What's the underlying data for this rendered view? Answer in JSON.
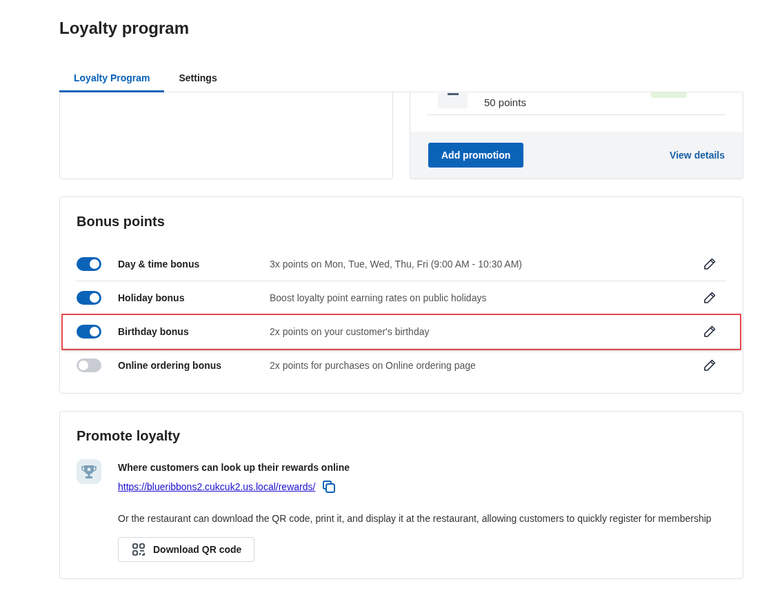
{
  "page": {
    "title": "Loyalty program"
  },
  "tabs": [
    {
      "label": "Loyalty Program",
      "selected": true
    },
    {
      "label": "Settings",
      "selected": false
    }
  ],
  "promotion_card": {
    "item_points": "50 points",
    "primary_button": "Add promotion",
    "link": "View details"
  },
  "bonus_points": {
    "title": "Bonus points",
    "rows": [
      {
        "name": "Day & time bonus",
        "description": "3x points on Mon, Tue, Wed, Thu, Fri (9:00 AM - 10:30 AM)",
        "on": true,
        "highlighted": false
      },
      {
        "name": "Holiday bonus",
        "description": "Boost loyalty point earning rates on public holidays",
        "on": true,
        "highlighted": false
      },
      {
        "name": "Birthday bonus",
        "description": "2x points on your customer's birthday",
        "on": true,
        "highlighted": true
      },
      {
        "name": "Online ordering bonus",
        "description": "2x points for purchases on Online ordering page",
        "on": false,
        "highlighted": false
      }
    ]
  },
  "promote_loyalty": {
    "title": "Promote loyalty",
    "heading": "Where customers can look up their rewards online",
    "url": "https://blueribbons2.cukcuk2.us.local/rewards/",
    "qr_text": "Or the restaurant can download the QR code, print it, and display it at the restaurant, allowing customers to quickly register for membership",
    "qr_button": "Download QR code"
  }
}
